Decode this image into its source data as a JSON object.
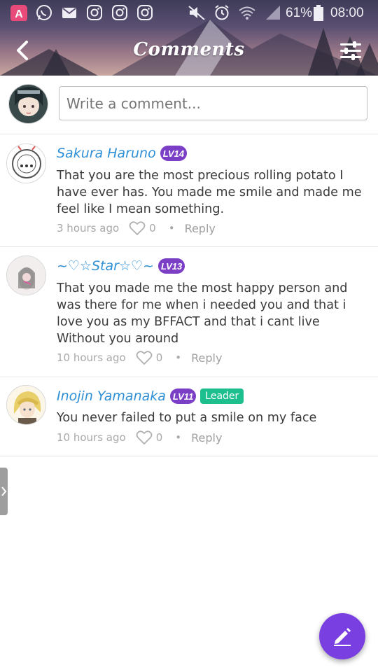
{
  "status_bar": {
    "battery_percent": "61%",
    "time": "08:00",
    "icons": [
      "app-store-icon",
      "whatsapp-icon",
      "gmail-icon",
      "instagram-icon",
      "instagram-icon",
      "instagram-icon",
      "mute-icon",
      "alarm-icon",
      "wifi-icon",
      "signal-icon",
      "battery-icon"
    ]
  },
  "app_bar": {
    "title": "Comments",
    "back_icon": "chevron-left-icon",
    "filter_icon": "sliders-icon"
  },
  "composer": {
    "placeholder": "Write a comment..."
  },
  "comments": [
    {
      "author": "Sakura Haruno",
      "level": "LV14",
      "text": "That you are the most precious rolling potato I have ever has. You made me smile and made me feel like I mean something.",
      "time": "3 hours ago",
      "likes": "0",
      "reply_label": "Reply"
    },
    {
      "author": "~♡☆Star☆♡~",
      "level": "LV13",
      "text": "That you made me the most happy person and was there for me when i needed you and that i love you as my BFFACT and that i cant live Without you around",
      "time": "10 hours ago",
      "likes": "0",
      "reply_label": "Reply"
    },
    {
      "author": "Inojin Yamanaka",
      "level": "LV11",
      "badge": "Leader",
      "text": "You never failed to put a smile on my face",
      "time": "10 hours ago",
      "likes": "0",
      "reply_label": "Reply"
    }
  ],
  "colors": {
    "author_name": "#2e8fd6",
    "level_badge": "#7b3fc6",
    "leader_badge": "#1dbf8e",
    "fab": "#7a3fe0"
  },
  "fab": {
    "icon": "pencil-icon"
  }
}
